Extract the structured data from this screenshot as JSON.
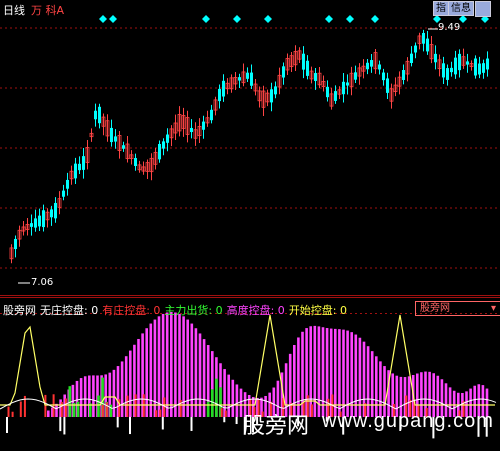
{
  "header": {
    "period": "日线",
    "symbol": "万 科A",
    "button_zoom": "指",
    "button_info": "信息"
  },
  "price_panel": {
    "high_label": "9.49",
    "low_label": "7.06"
  },
  "indicator_panel": {
    "title": "股旁网",
    "items": [
      {
        "label": "无庄控盘:",
        "value": "0",
        "color": "#ffffff"
      },
      {
        "label": "有庄控盘:",
        "value": "0",
        "color": "#ff3333"
      },
      {
        "label": "主力出货:",
        "value": "0",
        "color": "#33ff33"
      },
      {
        "label": "高度控盘:",
        "value": "0",
        "color": "#ff44ff"
      },
      {
        "label": "开始控盘:",
        "value": "0",
        "color": "#ffff44"
      }
    ],
    "selector_value": "股旁网"
  },
  "watermark": {
    "cn": "股旁网",
    "url": "www.gupang.com"
  },
  "colors": {
    "up": "#ff4444",
    "down": "#00ffff",
    "grid": "#a01010",
    "magenta": "#ff44ff",
    "green": "#22dd22",
    "red": "#ff3333",
    "yellow": "#ffff66",
    "white": "#ffffff"
  }
}
